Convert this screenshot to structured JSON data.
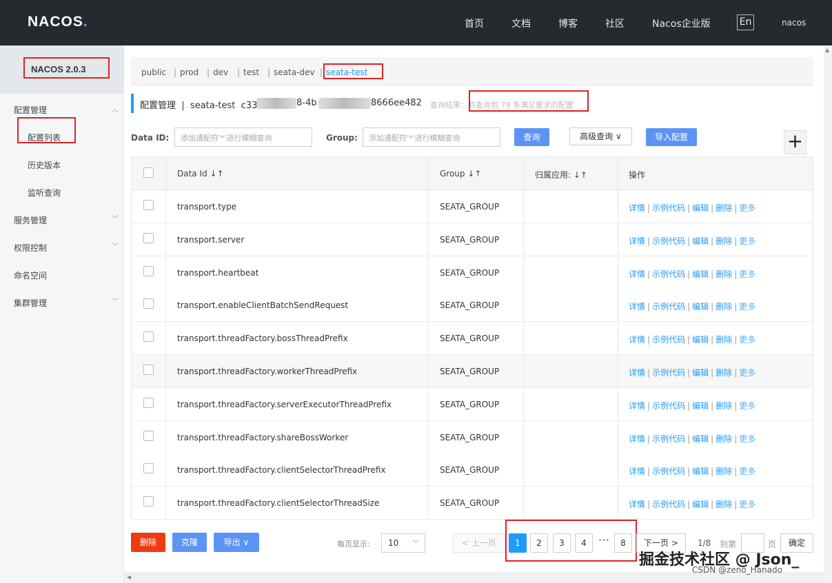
{
  "header": {
    "logo_main": "NACOS",
    "logo_dot": ".",
    "nav": [
      "首页",
      "文档",
      "博客",
      "社区",
      "Nacos企业版"
    ],
    "lang": "En",
    "user": "nacos"
  },
  "sidebar": {
    "version": "NACOS 2.0.3",
    "groups": [
      {
        "label": "配置管理",
        "expanded": true
      },
      {
        "label": "服务管理"
      },
      {
        "label": "权限控制"
      },
      {
        "label": "命名空间"
      },
      {
        "label": "集群管理"
      }
    ],
    "sub_items": [
      "配置列表",
      "历史版本",
      "监听查询"
    ]
  },
  "namespaces": {
    "tabs": [
      "public",
      "prod",
      "dev",
      "test",
      "seata-dev",
      "seata-test"
    ],
    "separator": "|",
    "active": "seata-test"
  },
  "title": {
    "section": "配置管理",
    "separator": "|",
    "namespace": "seata-test",
    "id_part1": "c33",
    "id_part2": "8-4b",
    "id_part3": "8666ee482",
    "result": "查询结果：共查询到 79 条满足要求的配置"
  },
  "search": {
    "dataid_label": "Data ID:",
    "dataid_placeholder": "添加通配符'*'进行模糊查询",
    "group_label": "Group:",
    "group_placeholder": "添加通配符'*'进行模糊查询",
    "query_btn": "查询",
    "advanced_btn": "高级查询",
    "advanced_arrow": "∨",
    "import_btn": "导入配置",
    "plus": "+"
  },
  "table": {
    "headers": [
      "Data Id",
      "Group",
      "归属应用:",
      "操作"
    ],
    "sort_icon": "↓↑",
    "rows": [
      {
        "data_id": "transport.type",
        "group": "SEATA_GROUP",
        "app": ""
      },
      {
        "data_id": "transport.server",
        "group": "SEATA_GROUP",
        "app": ""
      },
      {
        "data_id": "transport.heartbeat",
        "group": "SEATA_GROUP",
        "app": ""
      },
      {
        "data_id": "transport.enableClientBatchSendRequest",
        "group": "SEATA_GROUP",
        "app": ""
      },
      {
        "data_id": "transport.threadFactory.bossThreadPrefix",
        "group": "SEATA_GROUP",
        "app": ""
      },
      {
        "data_id": "transport.threadFactory.workerThreadPrefix",
        "group": "SEATA_GROUP",
        "app": ""
      },
      {
        "data_id": "transport.threadFactory.serverExecutorThreadPrefix",
        "group": "SEATA_GROUP",
        "app": ""
      },
      {
        "data_id": "transport.threadFactory.shareBossWorker",
        "group": "SEATA_GROUP",
        "app": ""
      },
      {
        "data_id": "transport.threadFactory.clientSelectorThreadPrefix",
        "group": "SEATA_GROUP",
        "app": ""
      },
      {
        "data_id": "transport.threadFactory.clientSelectorThreadSize",
        "group": "SEATA_GROUP",
        "app": ""
      }
    ],
    "ops": {
      "detail": "详情",
      "sample": "示例代码",
      "edit": "编辑",
      "delete": "删除",
      "more": "更多"
    }
  },
  "footer": {
    "delete_btn": "删除",
    "clone_btn": "克隆",
    "export_btn": "导出",
    "export_arrow": "∨",
    "page_size_label": "每页显示:",
    "page_size": "10",
    "prev": "上一页",
    "prev_arrow": "<",
    "pages": [
      "1",
      "2",
      "3",
      "4"
    ],
    "ellipsis": "•••",
    "last_page": "8",
    "next": "下一页",
    "next_arrow": ">",
    "page_info": "1/8",
    "goto_label": "到第",
    "goto_unit": "页",
    "confirm": "确定"
  },
  "watermark": {
    "main": "掘金技术社区 @ Json_",
    "small": "CSDN @zeno_Hanado"
  },
  "colors": {
    "accent": "#209bfa",
    "highlight_box": "#e02020",
    "danger": "#ef3b12",
    "topbar": "#252a2f"
  }
}
